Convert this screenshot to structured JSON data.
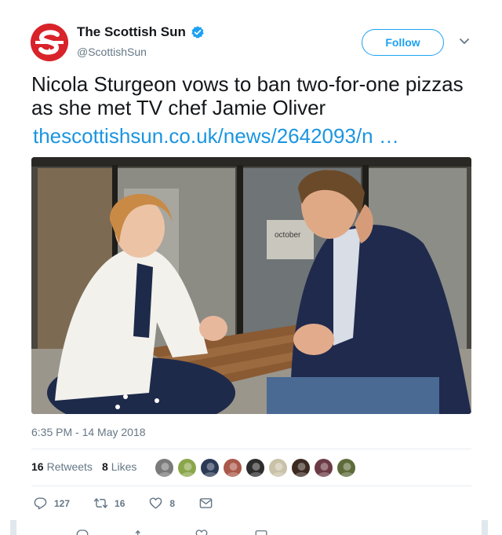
{
  "account": {
    "display_name": "The Scottish Sun",
    "handle": "@ScottishSun",
    "verified": true,
    "avatar_icon": "scottish-sun-logo",
    "brand_color": "#d9232a"
  },
  "follow_label": "Follow",
  "tweet": {
    "text": "Nicola Sturgeon vows to ban two-for-one pizzas as she met TV chef Jamie Oliver",
    "link": "thescottishsun.co.uk/news/2642093/n …",
    "timestamp": "6:35 PM - 14 May 2018",
    "media_icon": "photo-sturgeon-oliver"
  },
  "stats": {
    "retweets_count": "16",
    "retweets_label": "Retweets",
    "likes_count": "8",
    "likes_label": "Likes"
  },
  "likers": [
    {
      "icon": "liker-avatar-1",
      "color": "#7a7a7a"
    },
    {
      "icon": "liker-avatar-2",
      "color": "#8aa64a"
    },
    {
      "icon": "liker-avatar-3",
      "color": "#2b3a55"
    },
    {
      "icon": "liker-avatar-4",
      "color": "#a9584a"
    },
    {
      "icon": "liker-avatar-5",
      "color": "#2d2d2d"
    },
    {
      "icon": "liker-avatar-6",
      "color": "#c9c2a8"
    },
    {
      "icon": "liker-avatar-7",
      "color": "#3b2a20"
    },
    {
      "icon": "liker-avatar-8",
      "color": "#6b3a45"
    },
    {
      "icon": "liker-avatar-9",
      "color": "#5d6b3a"
    }
  ],
  "actions": {
    "reply_count": "127",
    "retweet_count": "16",
    "like_count": "8"
  },
  "colors": {
    "link": "#1b95e0",
    "follow": "#1da1f2",
    "muted": "#657786"
  }
}
